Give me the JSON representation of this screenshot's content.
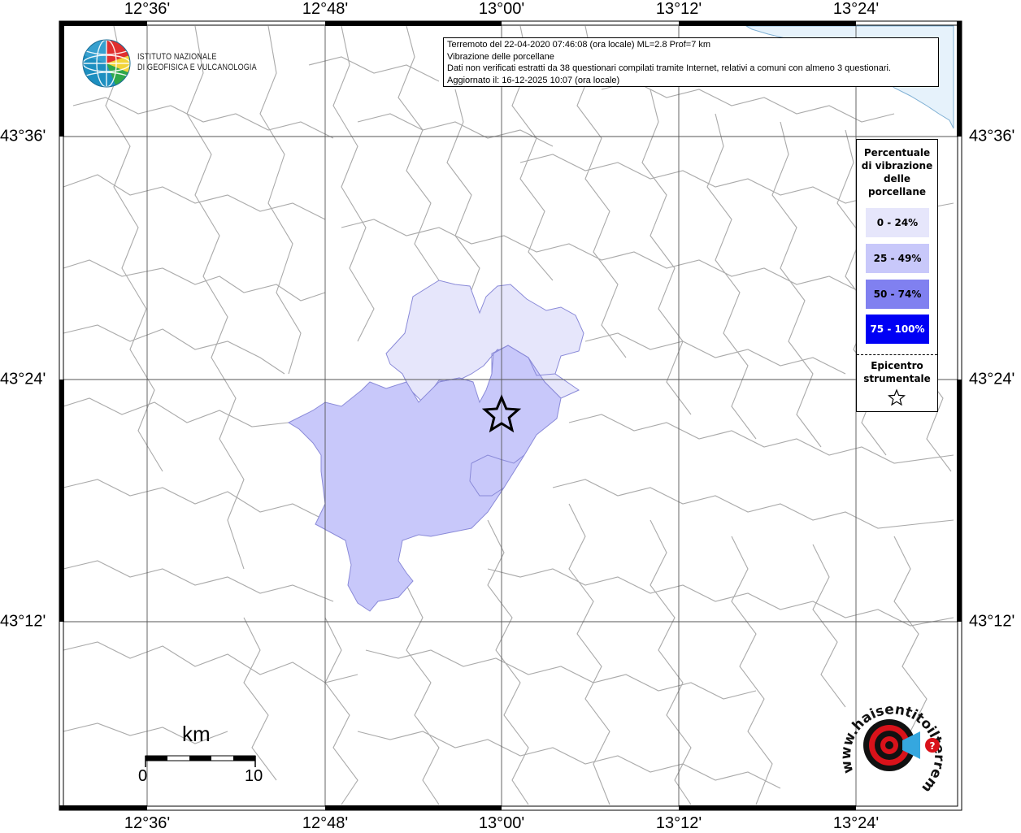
{
  "map": {
    "top_longitude_labels": [
      "12°36'",
      "12°48'",
      "13°00'",
      "13°12'",
      "13°24'"
    ],
    "bottom_longitude_labels": [
      "12°36'",
      "12°48'",
      "13°00'",
      "13°12'",
      "13°24'"
    ],
    "left_latitude_labels": [
      "43°36'",
      "43°24'",
      "43°12'"
    ],
    "right_latitude_labels": [
      "43°36'",
      "43°24'",
      "43°12'"
    ],
    "sea_color": "#e6f2fb",
    "border_color": "#aaaaaa"
  },
  "info": {
    "line1": "Terremoto del 22-04-2020 07:46:08 (ora locale) ML=2.8 Prof=7 km",
    "line2": "Vibrazione delle porcellane",
    "line3": "Dati non verificati estratti da 38 questionari compilati tramite Internet, relativi a comuni con almeno 3 questionari.",
    "line4": "Aggiornato il: 16-12-2025 10:07 (ora locale)"
  },
  "logo": {
    "line1": "ISTITUTO NAZIONALE",
    "line2": "DI GEOFISICA E VULCANOLOGIA"
  },
  "legend": {
    "title": [
      "Percentuale",
      "di vibrazione",
      "delle",
      "porcellane"
    ],
    "items": [
      {
        "label": "0 - 24%",
        "color": "#e6e6fb",
        "text_color": "#000000"
      },
      {
        "label": "25 - 49%",
        "color": "#c8c8fa",
        "text_color": "#000000"
      },
      {
        "label": "50 - 74%",
        "color": "#8080f0",
        "text_color": "#000000"
      },
      {
        "label": "75 - 100%",
        "color": "#0000f5",
        "text_color": "#ffffff"
      }
    ],
    "epicenter_title": [
      "Epicentro",
      "strumentale"
    ],
    "epicenter_icon": "star-icon"
  },
  "scale": {
    "unit": "km",
    "start": "0",
    "end": "10"
  },
  "watermark": {
    "text": "www.haisentitoilterremoto.it",
    "icon": "target-megaphone-icon",
    "accent": "#d9121a"
  }
}
